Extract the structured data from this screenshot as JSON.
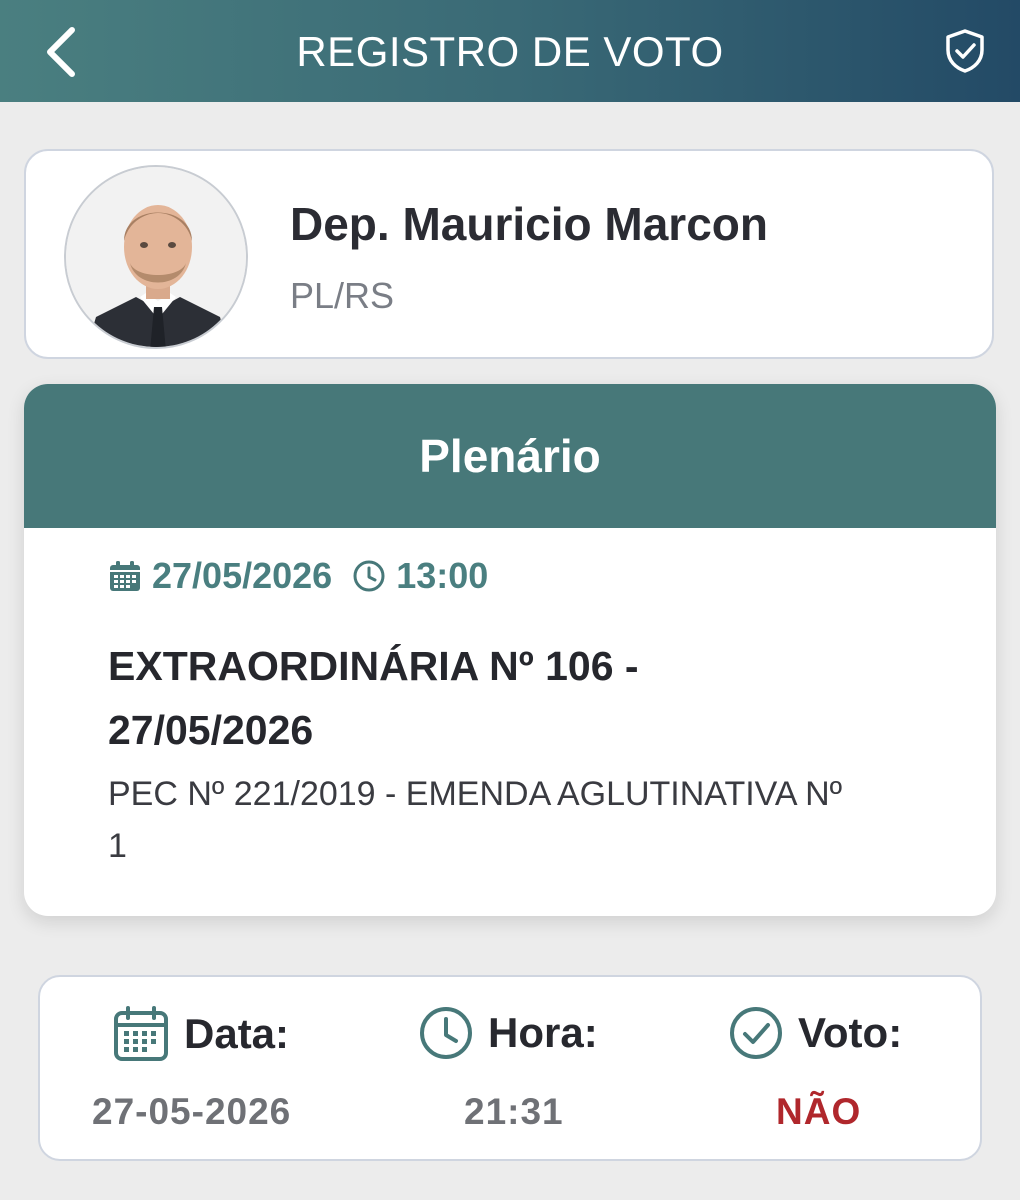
{
  "header": {
    "title": "REGISTRO DE VOTO",
    "back_icon": "chevron-left-icon",
    "shield_icon": "shield-check-icon"
  },
  "profile": {
    "name": "Dep. Mauricio Marcon",
    "party": "PL/RS"
  },
  "session": {
    "place": "Plenário",
    "date": "27/05/2026",
    "time": "13:00",
    "heading_line1": "EXTRAORDINÁRIA Nº 106 -",
    "heading_line2": "27/05/2026",
    "desc_line1": "PEC Nº 221/2019 - EMENDA AGLUTINATIVA Nº",
    "desc_line2": "1"
  },
  "vote": {
    "date_label": "Data:",
    "date_value": "27-05-2026",
    "time_label": "Hora:",
    "time_value": "21:31",
    "vote_label": "Voto:",
    "vote_value": "NÃO"
  },
  "colors": {
    "accent": "#477879",
    "vote_no": "#b0272c"
  }
}
